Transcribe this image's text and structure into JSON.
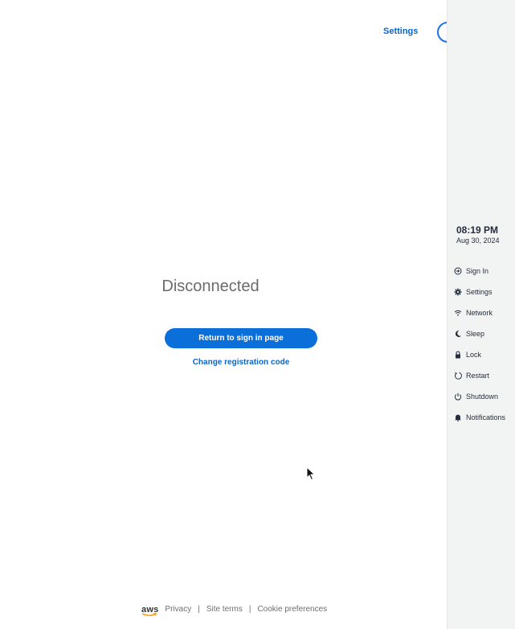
{
  "header": {
    "settings_label": "Settings"
  },
  "main": {
    "status": "Disconnected",
    "primary_button": "Return to sign in page",
    "secondary_link": "Change registration code"
  },
  "footer": {
    "logo_text": "aws",
    "links": [
      "Privacy",
      "Site terms",
      "Cookie preferences"
    ],
    "separator": "|"
  },
  "sidebar": {
    "time": "08:19 PM",
    "date": "Aug 30, 2024",
    "items": [
      {
        "label": "Sign In",
        "icon": "sign-in-icon"
      },
      {
        "label": "Settings",
        "icon": "gear-icon"
      },
      {
        "label": "Network",
        "icon": "wifi-icon"
      },
      {
        "label": "Sleep",
        "icon": "moon-icon"
      },
      {
        "label": "Lock",
        "icon": "lock-icon"
      },
      {
        "label": "Restart",
        "icon": "restart-icon"
      },
      {
        "label": "Shutdown",
        "icon": "power-icon"
      },
      {
        "label": "Notifications",
        "icon": "bell-icon"
      }
    ]
  },
  "colors": {
    "accent": "#0a6fd9",
    "link": "#0a66c8",
    "sidebar_bg": "#f2f3f3",
    "text_dark": "#232f3e"
  }
}
